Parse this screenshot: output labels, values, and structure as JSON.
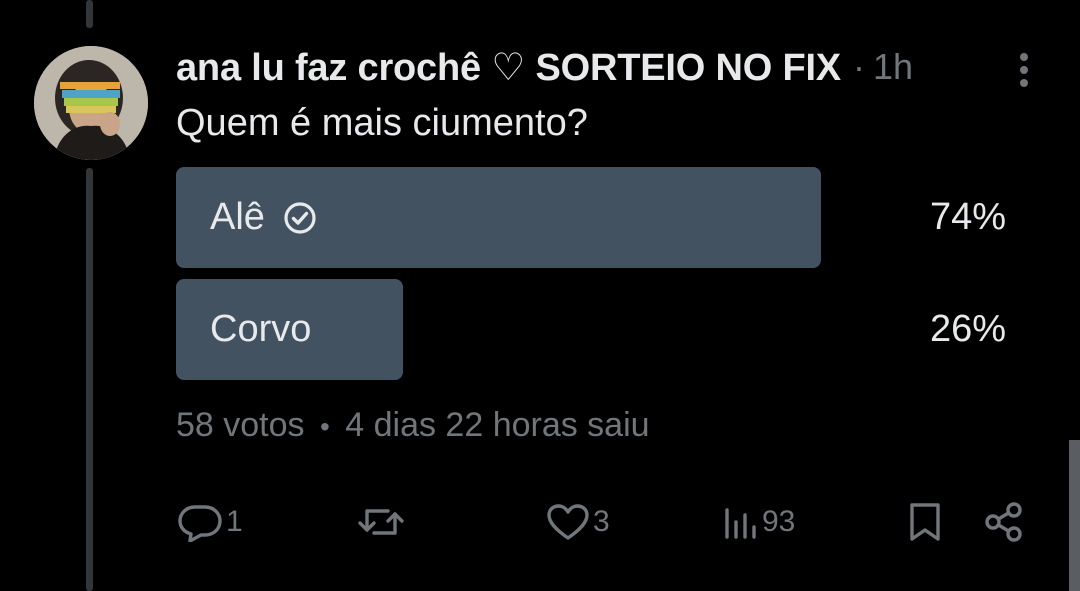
{
  "tweet": {
    "author_name": "ana lu faz crochê ♡ SORTEIO NO FIX",
    "separator": "·",
    "timestamp": "1h",
    "text": "Quem é mais ciumento?"
  },
  "poll": {
    "options": [
      {
        "label": "Alê",
        "percent_text": "74%",
        "fraction": 0.74,
        "selected": true
      },
      {
        "label": "Corvo",
        "percent_text": "26%",
        "fraction": 0.26,
        "selected": false
      }
    ],
    "votes_text": "58 votos",
    "meta_separator": "•",
    "time_left_text": "4 dias 22 horas saiu"
  },
  "actions": {
    "reply_count": "1",
    "retweet_count": "",
    "like_count": "3",
    "views_count": "93"
  },
  "colors": {
    "background": "#000000",
    "text_primary": "#e7e9ea",
    "text_secondary": "#71767b",
    "poll_bar": "#435261",
    "thread_line": "#333639"
  },
  "icons": [
    "more-icon",
    "check-circle-icon",
    "reply-icon",
    "retweet-icon",
    "like-icon",
    "views-icon",
    "bookmark-icon",
    "share-icon"
  ]
}
